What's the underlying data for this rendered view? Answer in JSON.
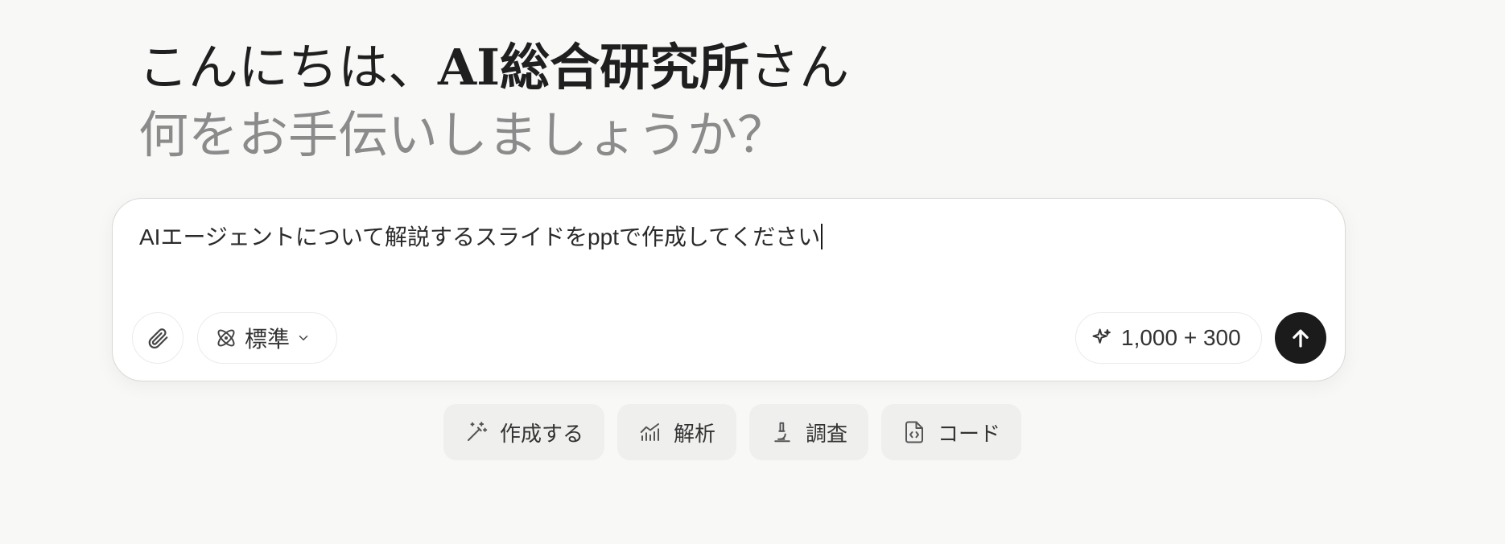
{
  "greeting": {
    "prefix": "こんにちは、",
    "name": "AI総合研究所",
    "suffix": "さん",
    "subtitle": "何をお手伝いしましょうか？"
  },
  "composer": {
    "input_value": "AIエージェントについて解説するスライドをpptで作成してください",
    "mode_label": "標準",
    "credits_label": "1,000 + 300"
  },
  "quick_actions": [
    {
      "label": "作成する",
      "icon": "magic-wand-icon"
    },
    {
      "label": "解析",
      "icon": "bar-chart-icon"
    },
    {
      "label": "調査",
      "icon": "microscope-icon"
    },
    {
      "label": "コード",
      "icon": "code-file-icon"
    }
  ],
  "colors": {
    "background": "#f8f8f7",
    "send_button": "#1b1b1b",
    "subtitle_text": "#8b8b8b",
    "quick_action_bg": "#efefee"
  }
}
